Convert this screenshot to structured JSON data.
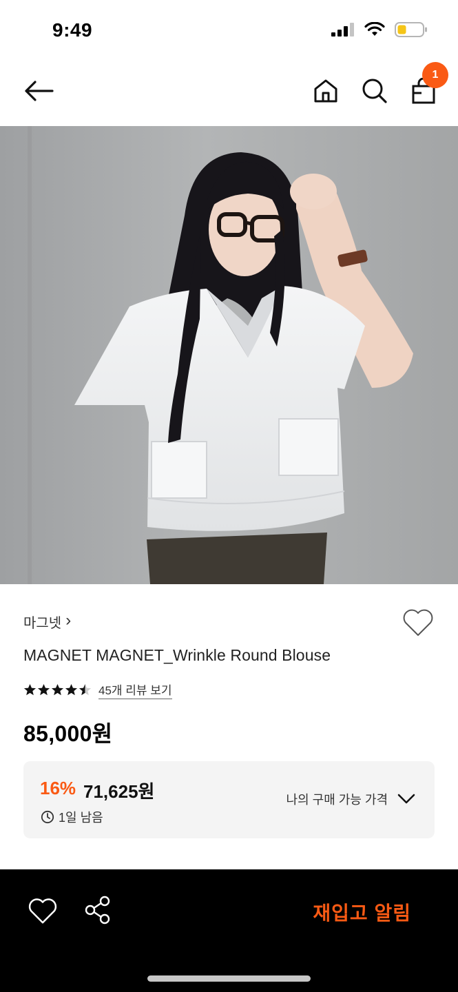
{
  "status": {
    "time": "9:49",
    "icons": [
      "cellular-icon",
      "wifi-icon",
      "battery-icon"
    ],
    "battery_color": "#f5c518"
  },
  "nav": {
    "back_icon": "arrow-left-icon",
    "home_icon": "home-icon",
    "search_icon": "search-icon",
    "bag_icon": "shopping-bag-icon",
    "cart_count": "1"
  },
  "product": {
    "brand": "마그넷",
    "brand_chevron": "›",
    "name": "MAGNET MAGNET_Wrinkle Round Blouse",
    "rating": 4.5,
    "review_link": "45개 리뷰 보기",
    "price": "85,000원",
    "offer": {
      "discount": "16%",
      "price": "71,625원",
      "time_left": "1일 남음",
      "toggle_label": "나의 구매 가능 가격"
    }
  },
  "bottom_bar": {
    "wish_icon": "heart-icon",
    "share_icon": "share-icon",
    "restock_label": "재입고 알림"
  },
  "colors": {
    "accent": "#fa5a14",
    "bottom_bar_bg": "#000000",
    "offer_bg": "#f4f4f4"
  }
}
